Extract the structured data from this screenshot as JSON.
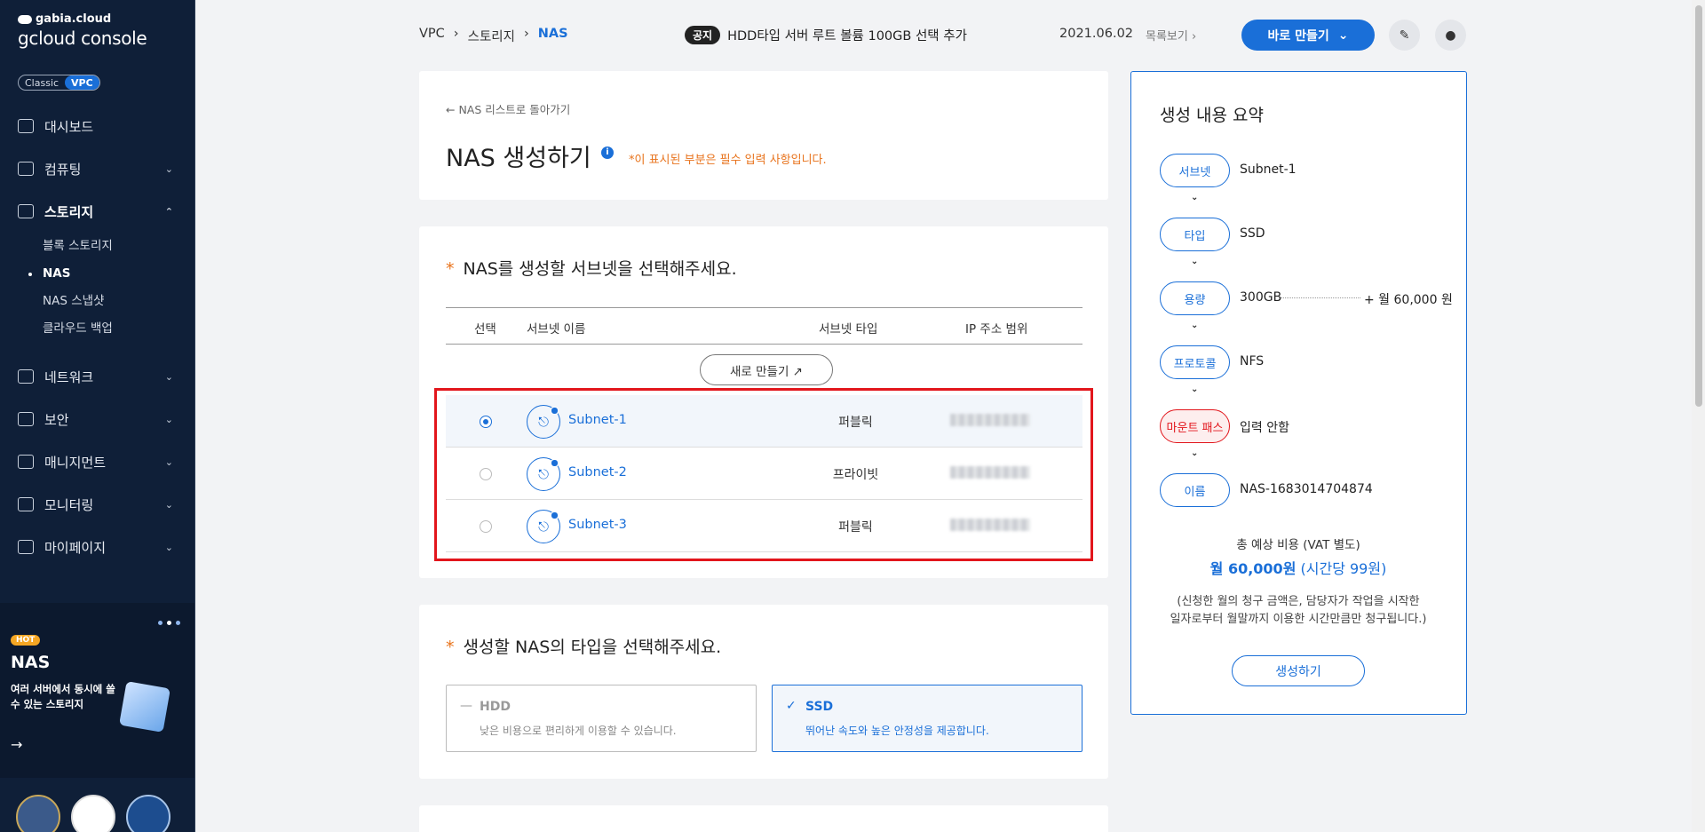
{
  "sidebar": {
    "logo_top": "gabia.cloud",
    "logo_main": "gcloud console",
    "toggle": {
      "classic": "Classic",
      "vpc": "VPC"
    },
    "items": [
      {
        "label": "대시보드",
        "icon": "dashboard-icon"
      },
      {
        "label": "컴퓨팅",
        "icon": "chip-icon"
      },
      {
        "label": "스토리지",
        "icon": "storage-icon"
      },
      {
        "label": "네트워크",
        "icon": "network-icon"
      },
      {
        "label": "보안",
        "icon": "shield-icon"
      },
      {
        "label": "매니지먼트",
        "icon": "management-icon"
      },
      {
        "label": "모니터링",
        "icon": "monitor-icon"
      },
      {
        "label": "마이페이지",
        "icon": "user-icon"
      }
    ],
    "storage_sub": [
      "블록 스토리지",
      "NAS",
      "NAS 스냅샷",
      "클라우드 백업"
    ],
    "promo": {
      "hot": "HOT",
      "title": "NAS",
      "desc": "여러 서버에서 동시에 쓸 수 있는 스토리지"
    }
  },
  "topbar": {
    "breadcrumb": [
      "VPC",
      "스토리지",
      "NAS"
    ],
    "notice_tag": "공지",
    "notice_text": "HDD타입 서버 루트 볼륨 100GB 선택 추가",
    "date": "2021.06.02",
    "list_view": "목록보기",
    "make_button": "바로 만들기"
  },
  "header": {
    "back": "NAS 리스트로 돌아가기",
    "title": "NAS 생성하기",
    "required_note": "*이 표시된 부분은 필수 입력 사항입니다."
  },
  "subnet_section": {
    "title": "NAS를 생성할 서브넷을 선택해주세요.",
    "columns": [
      "선택",
      "서브넷 이름",
      "서브넷 타입",
      "IP 주소 범위"
    ],
    "new_button": "새로 만들기 ↗",
    "rows": [
      {
        "name": "Subnet-1",
        "type": "퍼블릭",
        "selected": true
      },
      {
        "name": "Subnet-2",
        "type": "프라이빗",
        "selected": false
      },
      {
        "name": "Subnet-3",
        "type": "퍼블릭",
        "selected": false
      }
    ]
  },
  "type_section": {
    "title": "생성할 NAS의 타입을 선택해주세요.",
    "options": [
      {
        "name": "HDD",
        "desc": "낮은 비용으로 편리하게 이용할 수 있습니다.",
        "selected": false
      },
      {
        "name": "SSD",
        "desc": "뛰어난 속도와 높은 안정성을 제공합니다.",
        "selected": true
      }
    ]
  },
  "summary": {
    "title": "생성 내용 요약",
    "steps": [
      {
        "label": "서브넷",
        "value": "Subnet-1"
      },
      {
        "label": "타입",
        "value": "SSD"
      },
      {
        "label": "용량",
        "value": "300GB",
        "price": "+ 월 60,000 원"
      },
      {
        "label": "프로토콜",
        "value": "NFS"
      },
      {
        "label": "마운트 패스",
        "value": "입력 안함",
        "warn": true
      },
      {
        "label": "이름",
        "value": "NAS-1683014704874"
      }
    ],
    "total_label": "총 예상 비용 (VAT 별도)",
    "total_month": "월 60,000원",
    "total_hour": "(시간당 99원)",
    "note_line1": "(신청한 월의 청구 금액은, 담당자가 작업을 시작한",
    "note_line2": "일자로부터 월말까지 이용한 시간만큼만 청구됩니다.)",
    "create_button": "생성하기"
  }
}
